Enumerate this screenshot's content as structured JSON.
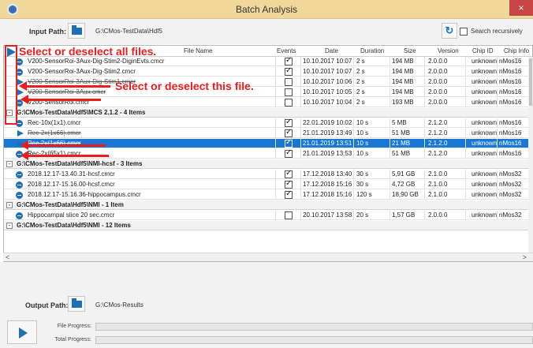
{
  "window": {
    "title": "Batch Analysis",
    "close_label": "×"
  },
  "input": {
    "label": "Input Path:",
    "path": "G:\\CMos-TestData\\Hdf5",
    "search_recursively_label": "Search recursively",
    "search_recursively_checked": false
  },
  "columns": {
    "file_name": "File Name",
    "events": "Events",
    "date": "Date",
    "duration": "Duration",
    "size": "Size",
    "version": "Version",
    "chip_id": "Chip ID",
    "chip_info": "Chip Info"
  },
  "groups": [
    {
      "title": "",
      "rows": [
        {
          "name": "V200-SensorRoi-3Aux-Dig-Stim2-DiginEvts.cmcr",
          "icon": "minus-icon",
          "events": true,
          "date": "10.10.2017 10:07",
          "duration": "2 s",
          "size": "194 MB",
          "version": "2.0.0.0",
          "chip_id": "unknown",
          "chip_info": "nMos16",
          "selected": false,
          "struck": false
        },
        {
          "name": "V200-SensorRoi-3Aux-Dig-Stim2.cmcr",
          "icon": "minus-icon",
          "events": true,
          "date": "10.10.2017 10:07",
          "duration": "2 s",
          "size": "194 MB",
          "version": "2.0.0.0",
          "chip_id": "unknown",
          "chip_info": "nMos16",
          "selected": false,
          "struck": false
        },
        {
          "name": "V200-SensorRoi-3Aux-Dig-Stim1.cmcr",
          "icon": "play-icon",
          "events": false,
          "date": "10.10.2017 10:06",
          "duration": "2 s",
          "size": "194 MB",
          "version": "2.0.0.0",
          "chip_id": "unknown",
          "chip_info": "nMos16",
          "selected": false,
          "struck": true
        },
        {
          "name": "V200-SensorRoi-3Aux.cmcr",
          "icon": "play-icon",
          "events": false,
          "date": "10.10.2017 10:05",
          "duration": "2 s",
          "size": "194 MB",
          "version": "2.0.0.0",
          "chip_id": "unknown",
          "chip_info": "nMos16",
          "selected": false,
          "struck": true
        },
        {
          "name": "V200-SensorRoi.cmcr",
          "icon": "minus-icon",
          "events": false,
          "date": "10.10.2017 10:04",
          "duration": "2 s",
          "size": "193 MB",
          "version": "2.0.0.0",
          "chip_id": "unknown",
          "chip_info": "nMos16",
          "selected": false,
          "struck": false
        }
      ]
    },
    {
      "title": "G:\\CMos-TestData\\Hdf5\\MCS 2.1.2 - 4 Items",
      "rows": [
        {
          "name": "Rec-10x(1x1).cmcr",
          "icon": "minus-icon",
          "events": true,
          "date": "22.01.2019 10:02",
          "duration": "10 s",
          "size": "5 MB",
          "version": "2.1.2.0",
          "chip_id": "unknown",
          "chip_info": "nMos16",
          "selected": false,
          "struck": false
        },
        {
          "name": "Rec-2x(1x66).cmcr",
          "icon": "play-icon",
          "events": true,
          "date": "21.01.2019 13:49",
          "duration": "10 s",
          "size": "51 MB",
          "version": "2.1.2.0",
          "chip_id": "unknown",
          "chip_info": "nMos16",
          "selected": false,
          "struck": true
        },
        {
          "name": "Rec-2x(1x66).cmcr",
          "icon": "play-icon",
          "events": true,
          "date": "21.01.2019 13:51",
          "duration": "10 s",
          "size": "21 MB",
          "version": "2.1.2.0",
          "chip_id": "unknown",
          "chip_info": "nMos16",
          "selected": true,
          "struck": true
        },
        {
          "name": "Rec-2x(65x1).cmcr",
          "icon": "minus-icon",
          "events": true,
          "date": "21.01.2019 13:53",
          "duration": "10 s",
          "size": "51 MB",
          "version": "2.1.2.0",
          "chip_id": "unknown",
          "chip_info": "nMos16",
          "selected": false,
          "struck": false
        }
      ]
    },
    {
      "title": "G:\\CMos-TestData\\Hdf5\\NMI-hcsf - 3 Items",
      "rows": [
        {
          "name": "2018.12.17-13.40.31-hcsf.cmcr",
          "icon": "minus-icon",
          "events": true,
          "date": "17.12.2018 13:40",
          "duration": "30 s",
          "size": "5,91 GB",
          "version": "2.1.0.0",
          "chip_id": "unknown",
          "chip_info": "nMos32",
          "selected": false,
          "struck": false
        },
        {
          "name": "2018.12.17-15.16.00-hcsf.cmcr",
          "icon": "minus-icon",
          "events": true,
          "date": "17.12.2018 15:16",
          "duration": "30 s",
          "size": "4,72 GB",
          "version": "2.1.0.0",
          "chip_id": "unknown",
          "chip_info": "nMos32",
          "selected": false,
          "struck": false
        },
        {
          "name": "2018.12.17-15.16.36-hippocampus.cmcr",
          "icon": "minus-icon",
          "events": true,
          "date": "17.12.2018 15:16",
          "duration": "120 s",
          "size": "18,90 GB",
          "version": "2.1.0.0",
          "chip_id": "unknown",
          "chip_info": "nMos32",
          "selected": false,
          "struck": false
        }
      ]
    },
    {
      "title": "G:\\CMos-TestData\\Hdf5\\NMI - 1 Item",
      "rows": [
        {
          "name": "Hippocampal slice 20 sec.cmcr",
          "icon": "minus-icon",
          "events": false,
          "date": "20.10.2017 13:58",
          "duration": "20 s",
          "size": "1,57 GB",
          "version": "2.0.0.0",
          "chip_id": "unknown",
          "chip_info": "nMos32",
          "selected": false,
          "struck": false
        }
      ]
    },
    {
      "title": "G:\\CMos-TestData\\Hdf5\\NMI - 12 Items",
      "rows": []
    }
  ],
  "annotations": {
    "select_all": "Select or deselect all files.",
    "select_file": "Select or deselect this file."
  },
  "output": {
    "label": "Output Path:",
    "path": "G:\\CMos-Results"
  },
  "progress": {
    "file_label": "File Progress:",
    "total_label": "Total Progress:",
    "file_value": 0,
    "total_value": 0
  },
  "colors": {
    "accent": "#1f6fb5",
    "selection": "#1a78d4",
    "annotation": "#ee1c1c",
    "titlebar": "#f0d89a"
  }
}
